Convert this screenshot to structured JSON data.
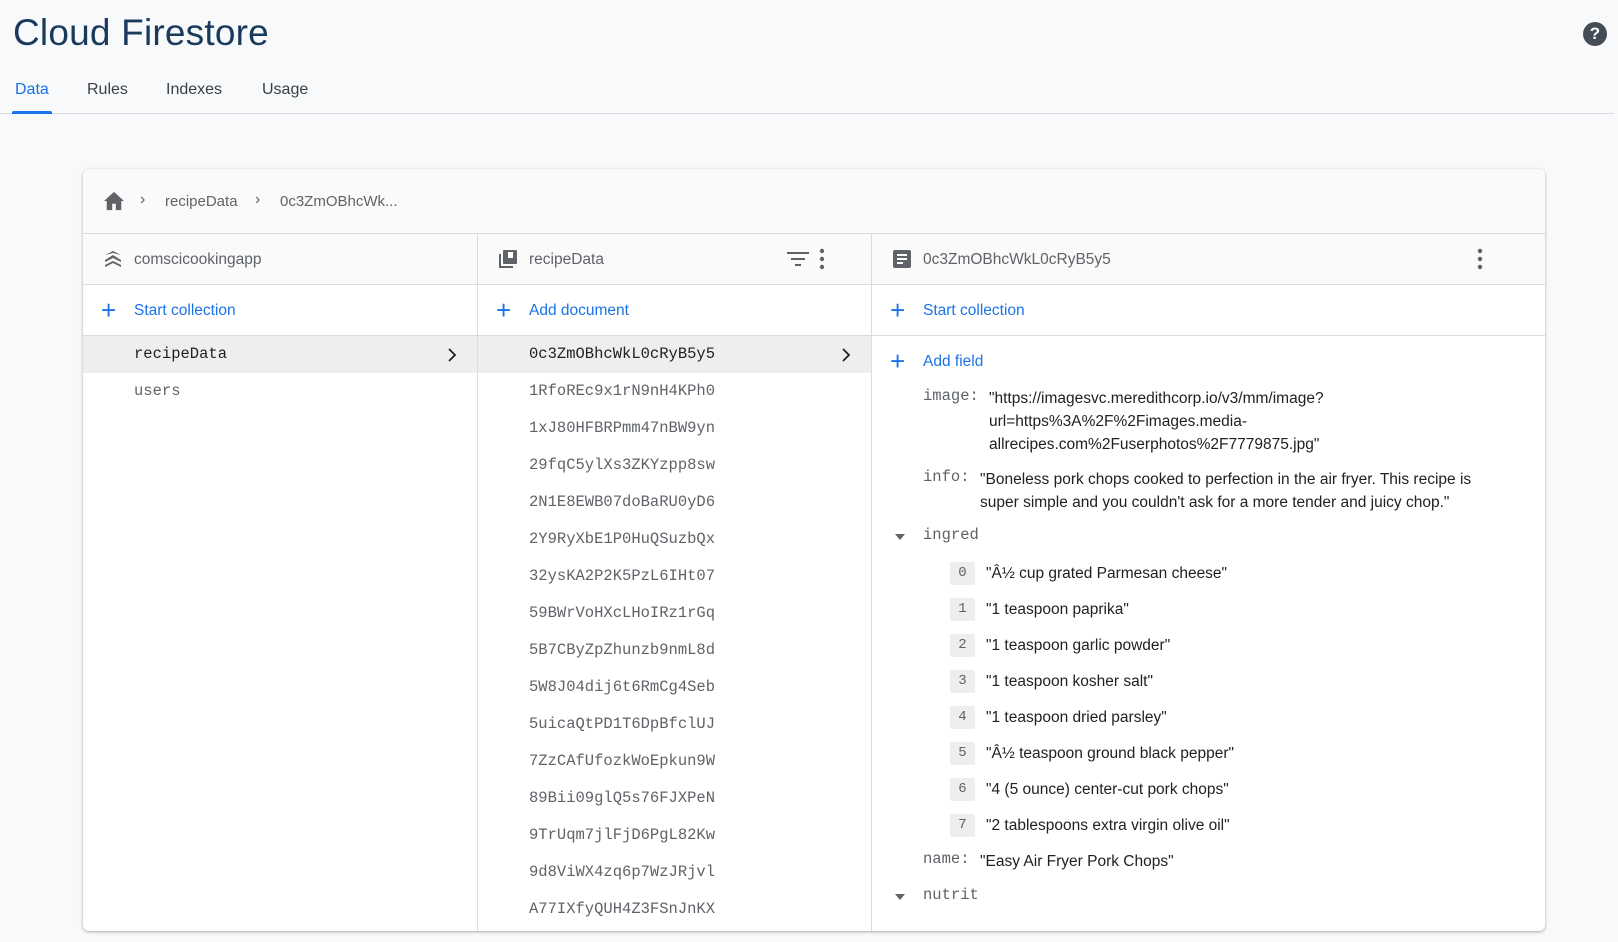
{
  "app": {
    "title": "Cloud Firestore"
  },
  "tabs": [
    {
      "label": "Data"
    },
    {
      "label": "Rules"
    },
    {
      "label": "Indexes"
    },
    {
      "label": "Usage"
    }
  ],
  "breadcrumb": {
    "items": [
      "recipeData",
      "0c3ZmOBhcWk..."
    ]
  },
  "columns": {
    "project": {
      "title": "comscicookingapp",
      "action": "Start collection",
      "items": [
        "recipeData",
        "users"
      ]
    },
    "collection": {
      "title": "recipeData",
      "action": "Add document",
      "items": [
        "0c3ZmOBhcWkL0cRyB5y5",
        "1RfoREc9x1rN9nH4KPh0",
        "1xJ80HFBRPmm47nBW9yn",
        "29fqC5ylXs3ZKYzpp8sw",
        "2N1E8EWB07doBaRU0yD6",
        "2Y9RyXbE1P0HuQSuzbQx",
        "32ysKA2P2K5PzL6IHt07",
        "59BWrVoHXcLHoIRz1rGq",
        "5B7CByZpZhunzb9nmL8d",
        "5W8J04dij6t6RmCg4Seb",
        "5uicaQtPD1T6DpBfclUJ",
        "7ZzCAfUfozkWoEpkun9W",
        "89Bii09glQ5s76FJXPeN",
        "9TrUqm7jlFjD6PgL82Kw",
        "9d8ViWX4zq6p7WzJRjvl",
        "A77IXfyQUH4Z3FSnJnKX"
      ]
    },
    "document": {
      "title": "0c3ZmOBhcWkL0cRyB5y5",
      "action": "Start collection",
      "add_field": "Add field",
      "fields": {
        "image_key": "image",
        "image_value": "\"https://imagesvc.meredithcorp.io/v3/mm/image?\nurl=https%3A%2F%2Fimages.media-\nallrecipes.com%2Fuserphotos%2F7779875.jpg\"",
        "info_key": "info",
        "info_value": "\"Boneless pork chops cooked to perfection in the air fryer. This recipe is\nsuper simple and you couldn't ask for a more tender and juicy chop.\"",
        "ingred_key": "ingred",
        "ingred": [
          "\"Â½ cup grated Parmesan cheese\"",
          "\"1 teaspoon paprika\"",
          "\"1 teaspoon garlic powder\"",
          "\"1 teaspoon kosher salt\"",
          "\"1 teaspoon dried parsley\"",
          "\"Â½ teaspoon ground black pepper\"",
          "\"4 (5 ounce) center-cut pork chops\"",
          "\"2 tablespoons extra virgin olive oil\""
        ],
        "name_key": "name",
        "name_value": "\"Easy Air Fryer Pork Chops\"",
        "nutrit_key": "nutrit"
      }
    }
  },
  "colors": {
    "accent": "#1a73e8",
    "title": "#1a3a5c"
  }
}
